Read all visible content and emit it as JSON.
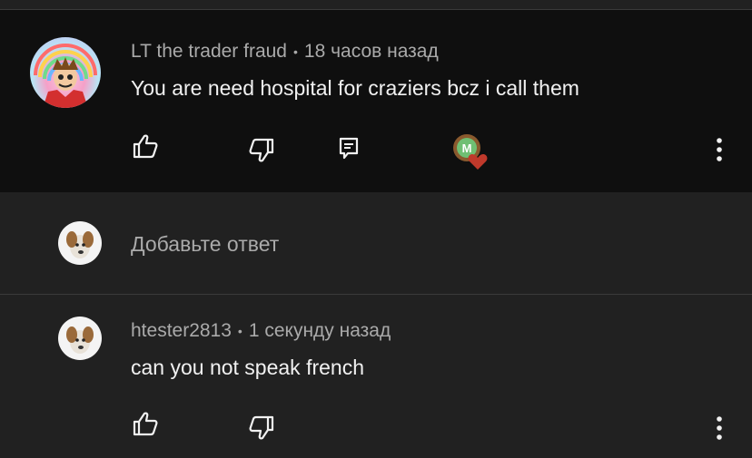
{
  "comment": {
    "author": "LT the trader fraud",
    "separator": "•",
    "time": "18 часов назад",
    "text": "You are need hospital for craziers bcz i call them"
  },
  "reply_input": {
    "placeholder": "Добавьте ответ"
  },
  "reply": {
    "author": "htester2813",
    "separator": "•",
    "time": "1 секунду назад",
    "text": "can you not speak french"
  },
  "icons": {
    "like": "thumbs-up-icon",
    "dislike": "thumbs-down-icon",
    "reply": "reply-icon",
    "creator_heart": "creator-heart-icon",
    "more": "more-vertical-icon"
  },
  "colors": {
    "background_main": "#0f0f0f",
    "background_reply": "#212121",
    "text_primary": "#f1f1f1",
    "text_secondary": "#aaaaaa",
    "heart": "#c0392b"
  }
}
